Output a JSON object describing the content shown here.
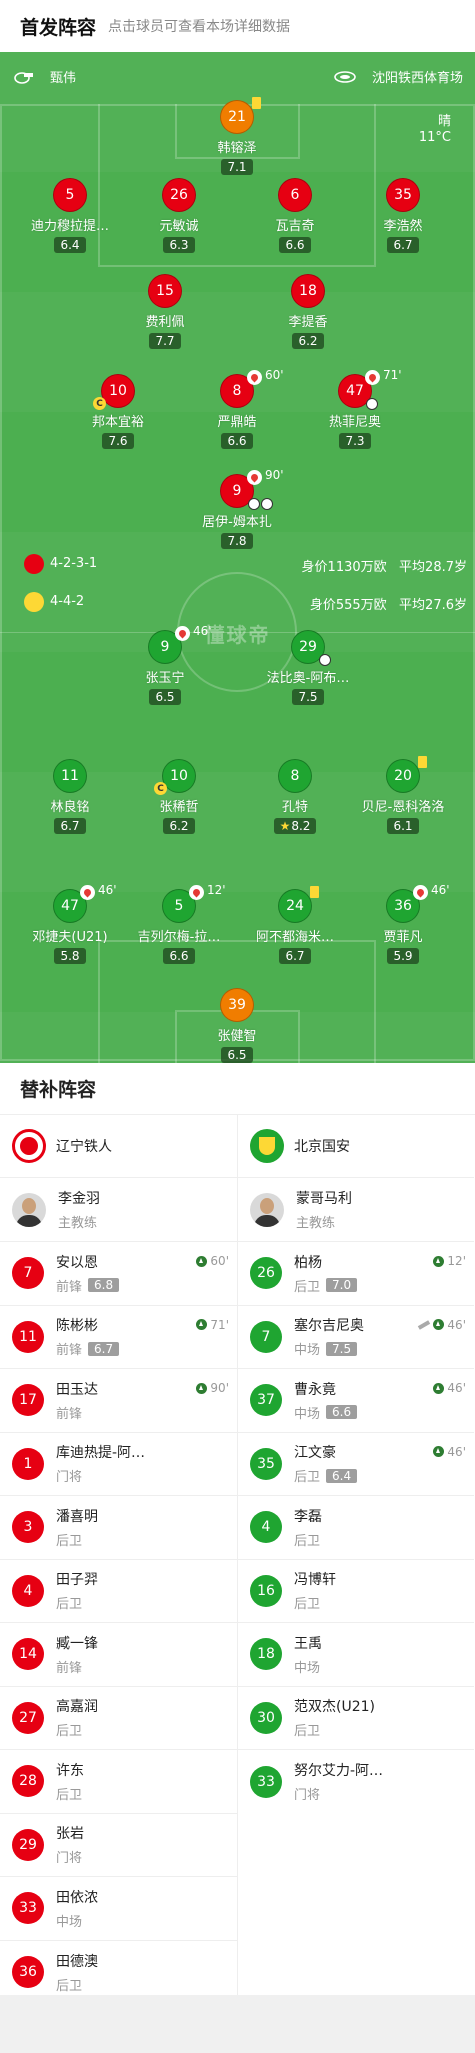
{
  "header": {
    "title": "首发阵容",
    "subtitle": "点击球员可查看本场详细数据"
  },
  "pitch": {
    "referee": "甄伟",
    "stadium": "沈阳铁西体育场",
    "weather": "晴",
    "temperature": "11°C",
    "watermark": "懂球帝",
    "home": {
      "formation": "4-2-3-1",
      "value": "身价1130万欧",
      "age": "平均28.7岁"
    },
    "away": {
      "formation": "4-4-2",
      "value": "身价555万欧",
      "age": "平均27.6岁"
    }
  },
  "home_players": [
    {
      "num": "21",
      "name": "韩镕泽",
      "rating": "7.1"
    },
    {
      "num": "5",
      "name": "迪力穆拉提…",
      "rating": "6.4"
    },
    {
      "num": "26",
      "name": "元敏诚",
      "rating": "6.3"
    },
    {
      "num": "6",
      "name": "瓦吉奇",
      "rating": "6.6"
    },
    {
      "num": "35",
      "name": "李浩然",
      "rating": "6.7"
    },
    {
      "num": "15",
      "name": "费利佩",
      "rating": "7.7"
    },
    {
      "num": "18",
      "name": "李提香",
      "rating": "6.2"
    },
    {
      "num": "10",
      "name": "邦本宜裕",
      "rating": "7.6"
    },
    {
      "num": "8",
      "name": "严鼎皓",
      "rating": "6.6",
      "sub": "60'"
    },
    {
      "num": "47",
      "name": "热菲尼奥",
      "rating": "7.3",
      "sub": "71'"
    },
    {
      "num": "9",
      "name": "居伊-姆本扎",
      "rating": "7.8",
      "sub": "90'"
    }
  ],
  "away_players": [
    {
      "num": "9",
      "name": "张玉宁",
      "rating": "6.5",
      "sub": "46'"
    },
    {
      "num": "29",
      "name": "法比奥-阿布…",
      "rating": "7.5"
    },
    {
      "num": "11",
      "name": "林良铭",
      "rating": "6.7"
    },
    {
      "num": "10",
      "name": "张稀哲",
      "rating": "6.2"
    },
    {
      "num": "8",
      "name": "孔特",
      "rating": "8.2"
    },
    {
      "num": "20",
      "name": "贝尼-恩科洛洛",
      "rating": "6.1"
    },
    {
      "num": "47",
      "name": "邓捷夫(U21)",
      "rating": "5.8",
      "sub": "46'"
    },
    {
      "num": "5",
      "name": "吉列尔梅-拉…",
      "rating": "6.6",
      "sub": "12'"
    },
    {
      "num": "24",
      "name": "阿不都海米…",
      "rating": "6.7"
    },
    {
      "num": "36",
      "name": "贾菲凡",
      "rating": "5.9",
      "sub": "46'"
    },
    {
      "num": "39",
      "name": "张健智",
      "rating": "6.5"
    }
  ],
  "subs": {
    "title": "替补阵容",
    "home": {
      "team": "辽宁铁人",
      "coach": {
        "name": "李金羽",
        "role": "主教练"
      },
      "players": [
        {
          "num": "7",
          "name": "安以恩",
          "pos": "前锋",
          "rating": "6.8",
          "time": "60'"
        },
        {
          "num": "11",
          "name": "陈彬彬",
          "pos": "前锋",
          "rating": "6.7",
          "time": "71'"
        },
        {
          "num": "17",
          "name": "田玉达",
          "pos": "前锋",
          "time": "90'"
        },
        {
          "num": "1",
          "name": "库迪热提-阿…",
          "pos": "门将"
        },
        {
          "num": "3",
          "name": "潘喜明",
          "pos": "后卫"
        },
        {
          "num": "4",
          "name": "田子羿",
          "pos": "后卫"
        },
        {
          "num": "14",
          "name": "臧一锋",
          "pos": "前锋"
        },
        {
          "num": "27",
          "name": "高嘉润",
          "pos": "后卫"
        },
        {
          "num": "28",
          "name": "许东",
          "pos": "后卫"
        },
        {
          "num": "29",
          "name": "张岩",
          "pos": "门将"
        },
        {
          "num": "33",
          "name": "田依浓",
          "pos": "中场"
        },
        {
          "num": "36",
          "name": "田德澳",
          "pos": "后卫"
        }
      ]
    },
    "away": {
      "team": "北京国安",
      "coach": {
        "name": "蒙哥马利",
        "role": "主教练"
      },
      "players": [
        {
          "num": "26",
          "name": "柏杨",
          "pos": "后卫",
          "rating": "7.0",
          "time": "12'"
        },
        {
          "num": "7",
          "name": "塞尔吉尼奥",
          "pos": "中场",
          "rating": "7.5",
          "time": "46'",
          "assist": true
        },
        {
          "num": "37",
          "name": "曹永竟",
          "pos": "中场",
          "rating": "6.6",
          "time": "46'"
        },
        {
          "num": "35",
          "name": "江文豪",
          "pos": "后卫",
          "rating": "6.4",
          "time": "46'"
        },
        {
          "num": "4",
          "name": "李磊",
          "pos": "后卫"
        },
        {
          "num": "16",
          "name": "冯博轩",
          "pos": "后卫"
        },
        {
          "num": "18",
          "name": "王禹",
          "pos": "中场"
        },
        {
          "num": "30",
          "name": "范双杰(U21)",
          "pos": "后卫"
        },
        {
          "num": "33",
          "name": "努尔艾力-阿…",
          "pos": "门将"
        }
      ]
    }
  },
  "colors": {
    "home": "#e60012",
    "away": "#1fa531",
    "keeper": "#f07d00",
    "pitch": "#4caf50"
  }
}
